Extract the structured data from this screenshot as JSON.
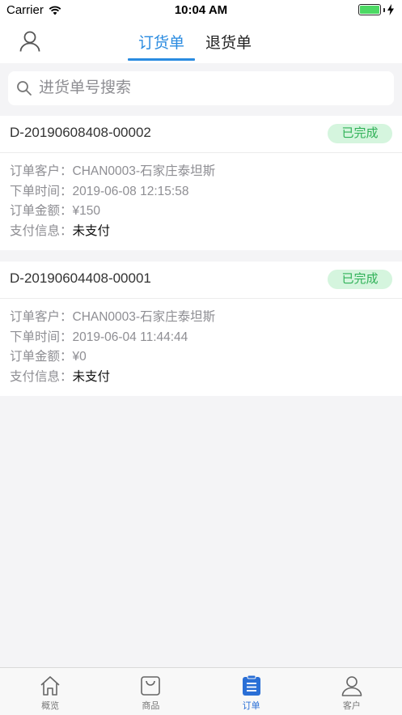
{
  "status_bar": {
    "carrier": "Carrier",
    "time": "10:04 AM"
  },
  "header": {
    "tabs": [
      {
        "label": "订货单",
        "active": true
      },
      {
        "label": "退货单",
        "active": false
      }
    ]
  },
  "search": {
    "placeholder": "进货单号搜索",
    "value": ""
  },
  "labels": {
    "customer": "订单客户：",
    "time": "下单时间：",
    "amount": "订单金额：",
    "payment": "支付信息："
  },
  "orders": [
    {
      "order_no": "D-20190608408-00002",
      "status": "已完成",
      "customer": "CHAN0003-石家庄泰坦斯",
      "time": "2019-06-08 12:15:58",
      "amount": "¥150",
      "payment": "未支付"
    },
    {
      "order_no": "D-20190604408-00001",
      "status": "已完成",
      "customer": "CHAN0003-石家庄泰坦斯",
      "time": "2019-06-04 11:44:44",
      "amount": "¥0",
      "payment": "未支付"
    }
  ],
  "tabbar": {
    "items": [
      {
        "label": "概览",
        "icon": "home-icon"
      },
      {
        "label": "商品",
        "icon": "bag-icon"
      },
      {
        "label": "订单",
        "icon": "clipboard-icon",
        "active": true
      },
      {
        "label": "客户",
        "icon": "user-icon"
      }
    ]
  },
  "colors": {
    "accent": "#2a8be0",
    "status_complete_bg": "#d5f5de",
    "status_complete_text": "#2fb157"
  }
}
